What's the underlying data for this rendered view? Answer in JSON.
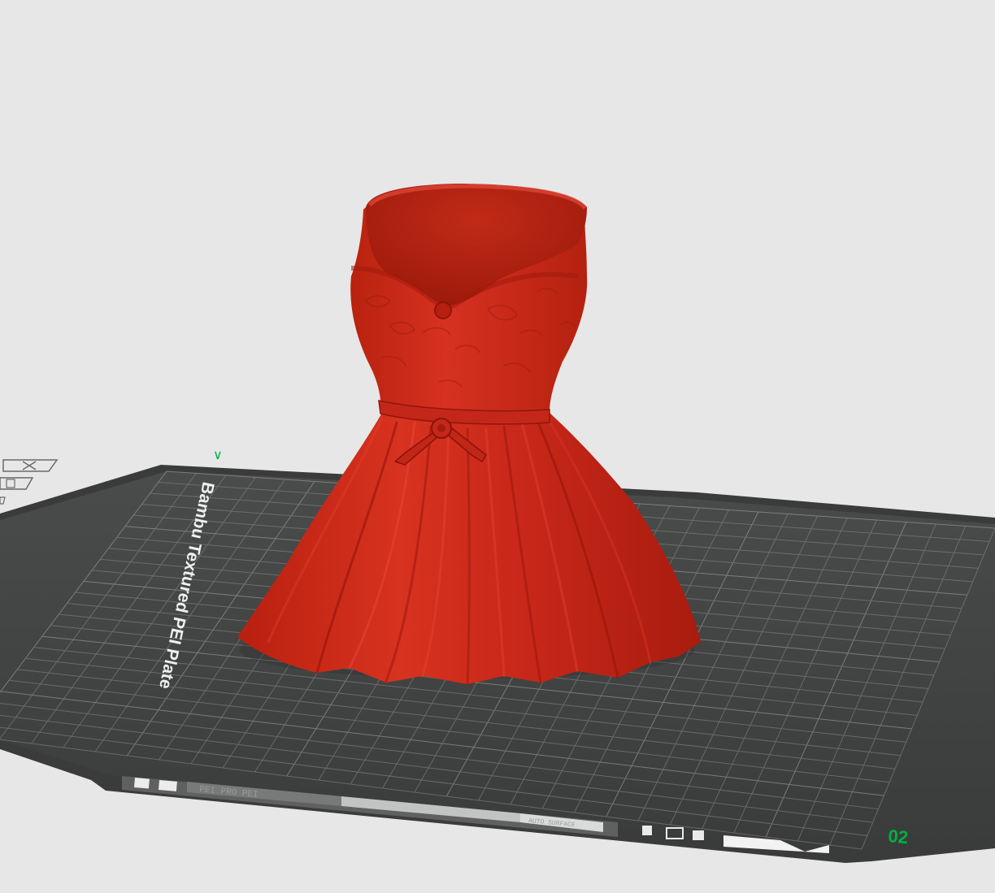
{
  "bed": {
    "label": "Bambu Textured PEI Plate",
    "plate_number": "02",
    "axis_marker": "∨",
    "strip_text": "PEI PRO PEI",
    "strip_text2": "AUTO SURFACE"
  },
  "model": {
    "name": "red-dress",
    "color": "#cf2a1b"
  },
  "toolbar": {
    "close_icon": "close-icon",
    "layout_icon": "layout-icon"
  }
}
